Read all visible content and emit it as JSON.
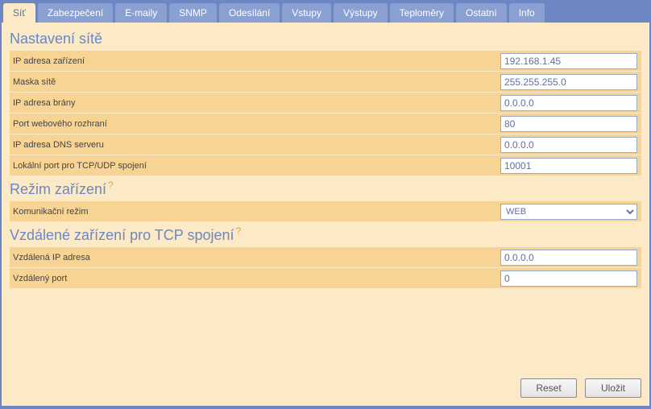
{
  "tabs": [
    {
      "id": "sit",
      "label": "Síť",
      "active": true
    },
    {
      "id": "zabezpeceni",
      "label": "Zabezpečení",
      "active": false
    },
    {
      "id": "emaily",
      "label": "E-maily",
      "active": false
    },
    {
      "id": "snmp",
      "label": "SNMP",
      "active": false
    },
    {
      "id": "odesilani",
      "label": "Odesílání",
      "active": false
    },
    {
      "id": "vstupy",
      "label": "Vstupy",
      "active": false
    },
    {
      "id": "vystupy",
      "label": "Výstupy",
      "active": false
    },
    {
      "id": "teplomery",
      "label": "Teploměry",
      "active": false
    },
    {
      "id": "ostatni",
      "label": "Ostatní",
      "active": false
    },
    {
      "id": "info",
      "label": "Info",
      "active": false
    }
  ],
  "sections": {
    "network": {
      "title": "Nastavení sítě",
      "rows": [
        {
          "id": "ip-device",
          "label": "IP adresa zařízení",
          "value": "192.168.1.45"
        },
        {
          "id": "netmask",
          "label": "Maska sítě",
          "value": "255.255.255.0"
        },
        {
          "id": "gateway",
          "label": "IP adresa brány",
          "value": "0.0.0.0"
        },
        {
          "id": "webport",
          "label": "Port webového rozhraní",
          "value": "80"
        },
        {
          "id": "dns",
          "label": "IP adresa DNS serveru",
          "value": "0.0.0.0"
        },
        {
          "id": "localport",
          "label": "Lokální port pro TCP/UDP spojení",
          "value": "10001"
        }
      ]
    },
    "mode": {
      "title": "Režim zařízení",
      "help": "?",
      "rows": [
        {
          "id": "comm-mode",
          "label": "Komunikační režim",
          "value": "WEB",
          "type": "select"
        }
      ]
    },
    "remote": {
      "title": "Vzdálené zařízení pro TCP spojení",
      "help": "?",
      "rows": [
        {
          "id": "remote-ip",
          "label": "Vzdálená IP adresa",
          "value": "0.0.0.0"
        },
        {
          "id": "remote-port",
          "label": "Vzdálený port",
          "value": "0"
        }
      ]
    }
  },
  "buttons": {
    "reset": "Reset",
    "save": "Uložit"
  }
}
